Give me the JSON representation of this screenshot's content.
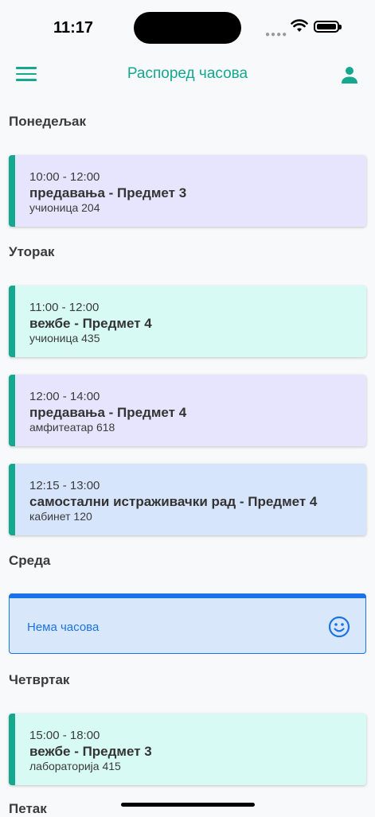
{
  "status": {
    "time": "11:17"
  },
  "header": {
    "title": "Распоред часова"
  },
  "days": [
    {
      "name": "Понедељак"
    },
    {
      "name": "Уторак"
    },
    {
      "name": "Среда"
    },
    {
      "name": "Четвртак"
    },
    {
      "name": "Петак"
    }
  ],
  "classes": [
    {
      "time": "10:00 - 12:00",
      "name": "предавања - Предмет 3",
      "room": "учионица 204",
      "color": "#e6e5fd"
    },
    {
      "time": "11:00 - 12:00",
      "name": "вежбе - Предмет 4",
      "room": "учионица 435",
      "color": "#d7faf4"
    },
    {
      "time": "12:00 - 14:00",
      "name": "предавања - Предмет 4",
      "room": "амфитеатар 618",
      "color": "#e6e5fd"
    },
    {
      "time": "12:15 - 13:00",
      "name": "самостални истраживачки рад - Предмет 4",
      "room": "кабинет 120",
      "color": "#d6e5fb"
    },
    {
      "time": "15:00 - 18:00",
      "name": "вежбе - Предмет 3",
      "room": "лабораторија 415",
      "color": "#d7faf4"
    }
  ],
  "empty_day": {
    "text": "Нема часова",
    "icon": "smile-icon"
  },
  "colors": {
    "accent": "#14a88f",
    "info": "#1a73e8"
  }
}
